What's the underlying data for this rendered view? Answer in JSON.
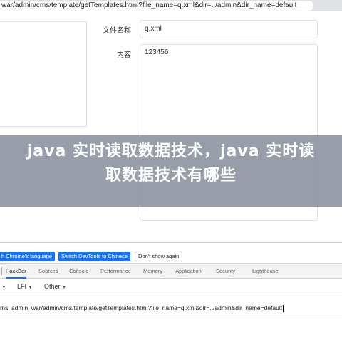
{
  "browser": {
    "address_url": "war/admin/cms/template/getTemplates.html?file_name=q.xml&dir=../admin&dir_name=default"
  },
  "form": {
    "filename_label": "文件名称",
    "filename_value": "q.xml",
    "content_label": "内容",
    "content_value": "123456"
  },
  "banner": {
    "title": "java 实时读取数据技术，java 实时读取数据技术有哪些"
  },
  "devtools": {
    "infobar": {
      "language_button": "h Chrome's language",
      "switch_button": "Switch DevTools to Chinese",
      "dismiss_button": "Don't show again"
    },
    "tabs": [
      "HackBar",
      "Sources",
      "Console",
      "Performance",
      "Memory",
      "Application",
      "Security",
      "Lighthouse"
    ],
    "active_tab": "HackBar",
    "hackbar": {
      "lfi_label": "LFI",
      "other_label": "Other",
      "url_value": "ms_admin_war/admin/cms/template/getTemplates.html?file_name=q.xml&dir=../admin&dir_name=default"
    }
  },
  "icons": {
    "dropdown": "chevron-down-icon"
  },
  "colors": {
    "banner_bg": "#8c94a0",
    "accent": "#1a73e8"
  }
}
